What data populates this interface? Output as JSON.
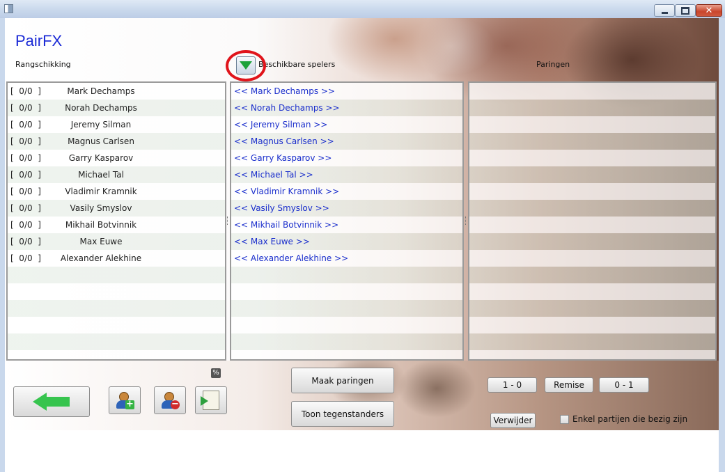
{
  "app": {
    "title": "PairFX"
  },
  "columns": {
    "ranking_label": "Rangschikking",
    "available_label": "Beschikbare spelers",
    "pairings_label": "Paringen"
  },
  "ranking": [
    {
      "score": "[  0/0  ]",
      "name": "Mark Dechamps"
    },
    {
      "score": "[  0/0  ]",
      "name": "Norah Dechamps"
    },
    {
      "score": "[  0/0  ]",
      "name": "Jeremy Silman"
    },
    {
      "score": "[  0/0  ]",
      "name": "Magnus Carlsen"
    },
    {
      "score": "[  0/0  ]",
      "name": "Garry Kasparov"
    },
    {
      "score": "[  0/0  ]",
      "name": "Michael Tal"
    },
    {
      "score": "[  0/0  ]",
      "name": "Vladimir Kramnik"
    },
    {
      "score": "[  0/0  ]",
      "name": "Vasily Smyslov"
    },
    {
      "score": "[  0/0  ]",
      "name": "Mikhail Botvinnik"
    },
    {
      "score": "[  0/0  ]",
      "name": "Max Euwe"
    },
    {
      "score": "[  0/0  ]",
      "name": "Alexander Alekhine"
    }
  ],
  "available": [
    "<< Mark Dechamps >>",
    "<< Norah Dechamps >>",
    "<< Jeremy Silman >>",
    "<< Magnus Carlsen >>",
    "<< Garry Kasparov >>",
    "<< Michael Tal >>",
    "<< Vladimir Kramnik >>",
    "<< Vasily Smyslov >>",
    "<< Mikhail Botvinnik >>",
    "<< Max Euwe >>",
    "<< Alexander Alekhine >>"
  ],
  "pairings": [],
  "toolbar": {
    "percent_icon_text": "%",
    "make_pairings_label": "Maak paringen",
    "show_opponents_label": "Toon tegenstanders",
    "result_white_win": "1 - 0",
    "result_draw": "Remise",
    "result_black_win": "0 - 1",
    "delete_label": "Verwijder",
    "only_ongoing_label": "Enkel partijen die bezig zijn",
    "only_ongoing_checked": false
  },
  "colors": {
    "accent_title": "#1c2bd6",
    "player_link": "#1a2ecc",
    "highlight_ring": "#e0141b",
    "arrow_green": "#36c44e"
  },
  "icons": {
    "back": "arrow-left-icon",
    "add_player": "add-user-icon",
    "remove_player": "remove-user-icon",
    "export": "export-document-icon",
    "dropdown": "triangle-down-icon",
    "percent": "percent-icon"
  }
}
